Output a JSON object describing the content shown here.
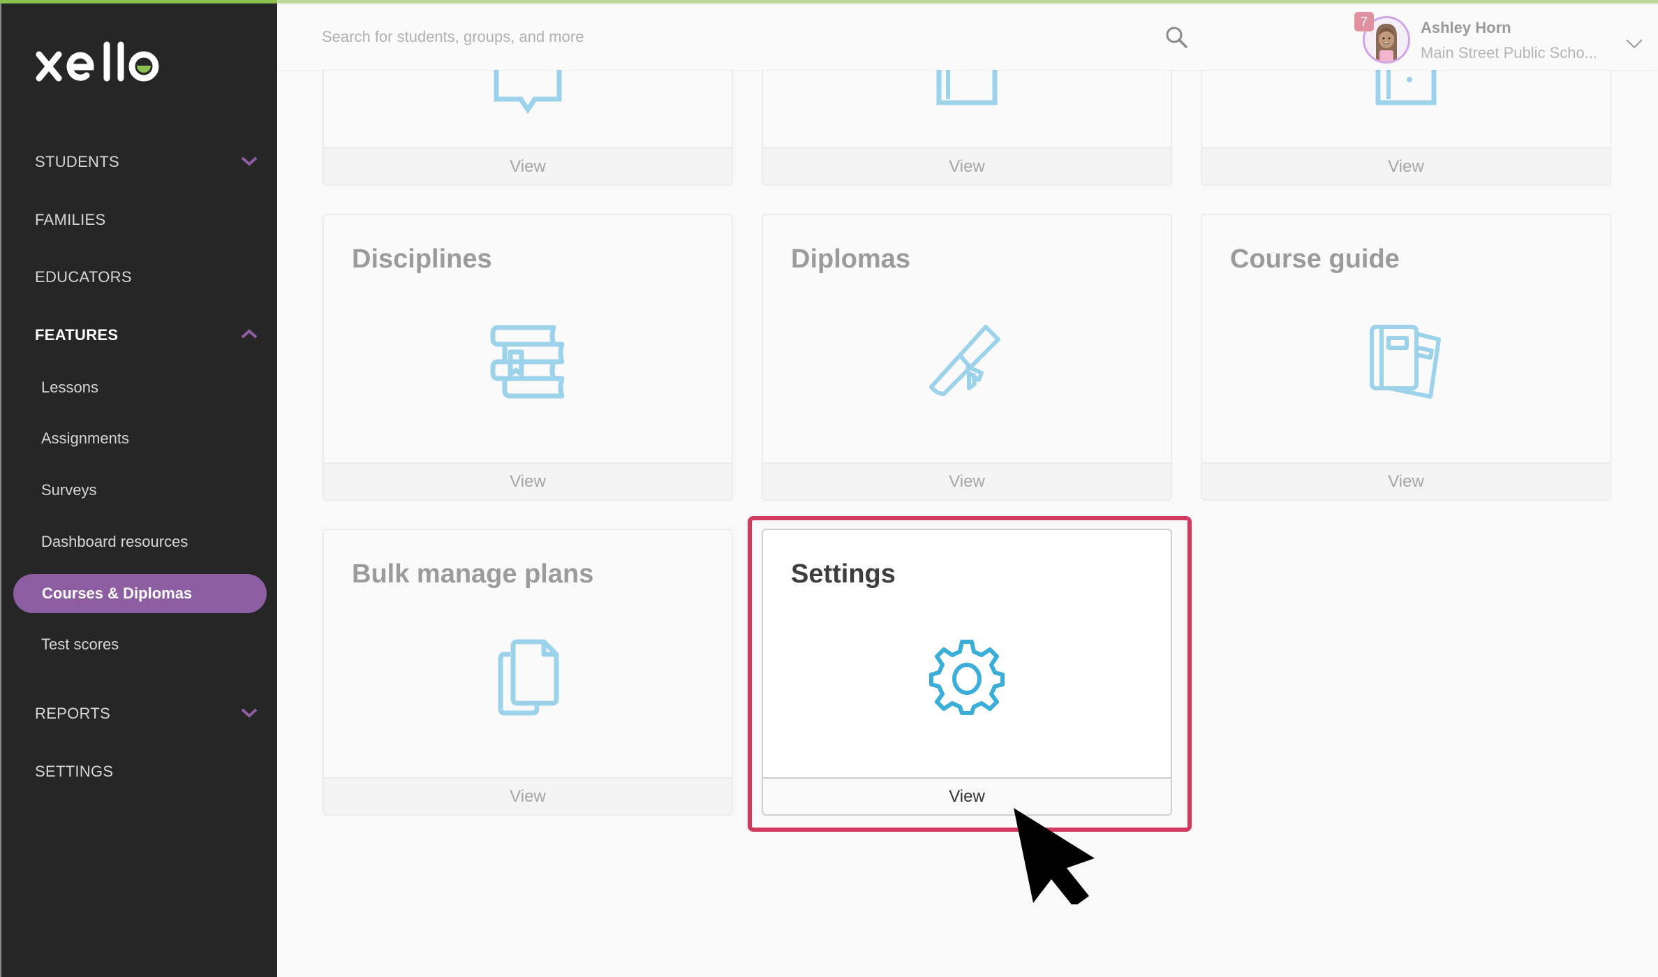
{
  "app": {
    "brand": "xello",
    "accent_color": "#8e5ea2",
    "brand_green": "#8cc152",
    "highlight_color": "#d23a5f",
    "icon_color": "#9dd3ea",
    "active_icon_color": "#3aaed8"
  },
  "header": {
    "search_placeholder": "Search for students, groups, and more",
    "user": {
      "name": "Ashley Horn",
      "school": "Main Street Public Scho...",
      "notification_count": "7"
    }
  },
  "sidebar": {
    "nav": [
      {
        "label": "STUDENTS",
        "expandable": true,
        "expanded": false
      },
      {
        "label": "FAMILIES"
      },
      {
        "label": "EDUCATORS"
      },
      {
        "label": "FEATURES",
        "expandable": true,
        "expanded": true,
        "active": true
      },
      {
        "label": "REPORTS",
        "expandable": true,
        "expanded": false
      },
      {
        "label": "SETTINGS"
      }
    ],
    "features_sub": [
      {
        "label": "Lessons"
      },
      {
        "label": "Assignments"
      },
      {
        "label": "Surveys"
      },
      {
        "label": "Dashboard resources"
      },
      {
        "label": "Courses & Diplomas",
        "active": true
      },
      {
        "label": "Test scores"
      }
    ]
  },
  "main": {
    "cards_top_row_partial": [
      {
        "view_label": "View",
        "icon": "partial-icon"
      },
      {
        "view_label": "View",
        "icon": "partial-icon"
      },
      {
        "view_label": "View",
        "icon": "partial-icon"
      }
    ],
    "cards": [
      {
        "title": "Disciplines",
        "icon": "books-icon",
        "view_label": "View"
      },
      {
        "title": "Diplomas",
        "icon": "diploma-scroll-icon",
        "view_label": "View"
      },
      {
        "title": "Course guide",
        "icon": "course-guide-icon",
        "view_label": "View"
      },
      {
        "title": "Bulk manage plans",
        "icon": "documents-icon",
        "view_label": "View"
      },
      {
        "title": "Settings",
        "icon": "gear-icon",
        "view_label": "View",
        "highlighted": true
      }
    ]
  }
}
